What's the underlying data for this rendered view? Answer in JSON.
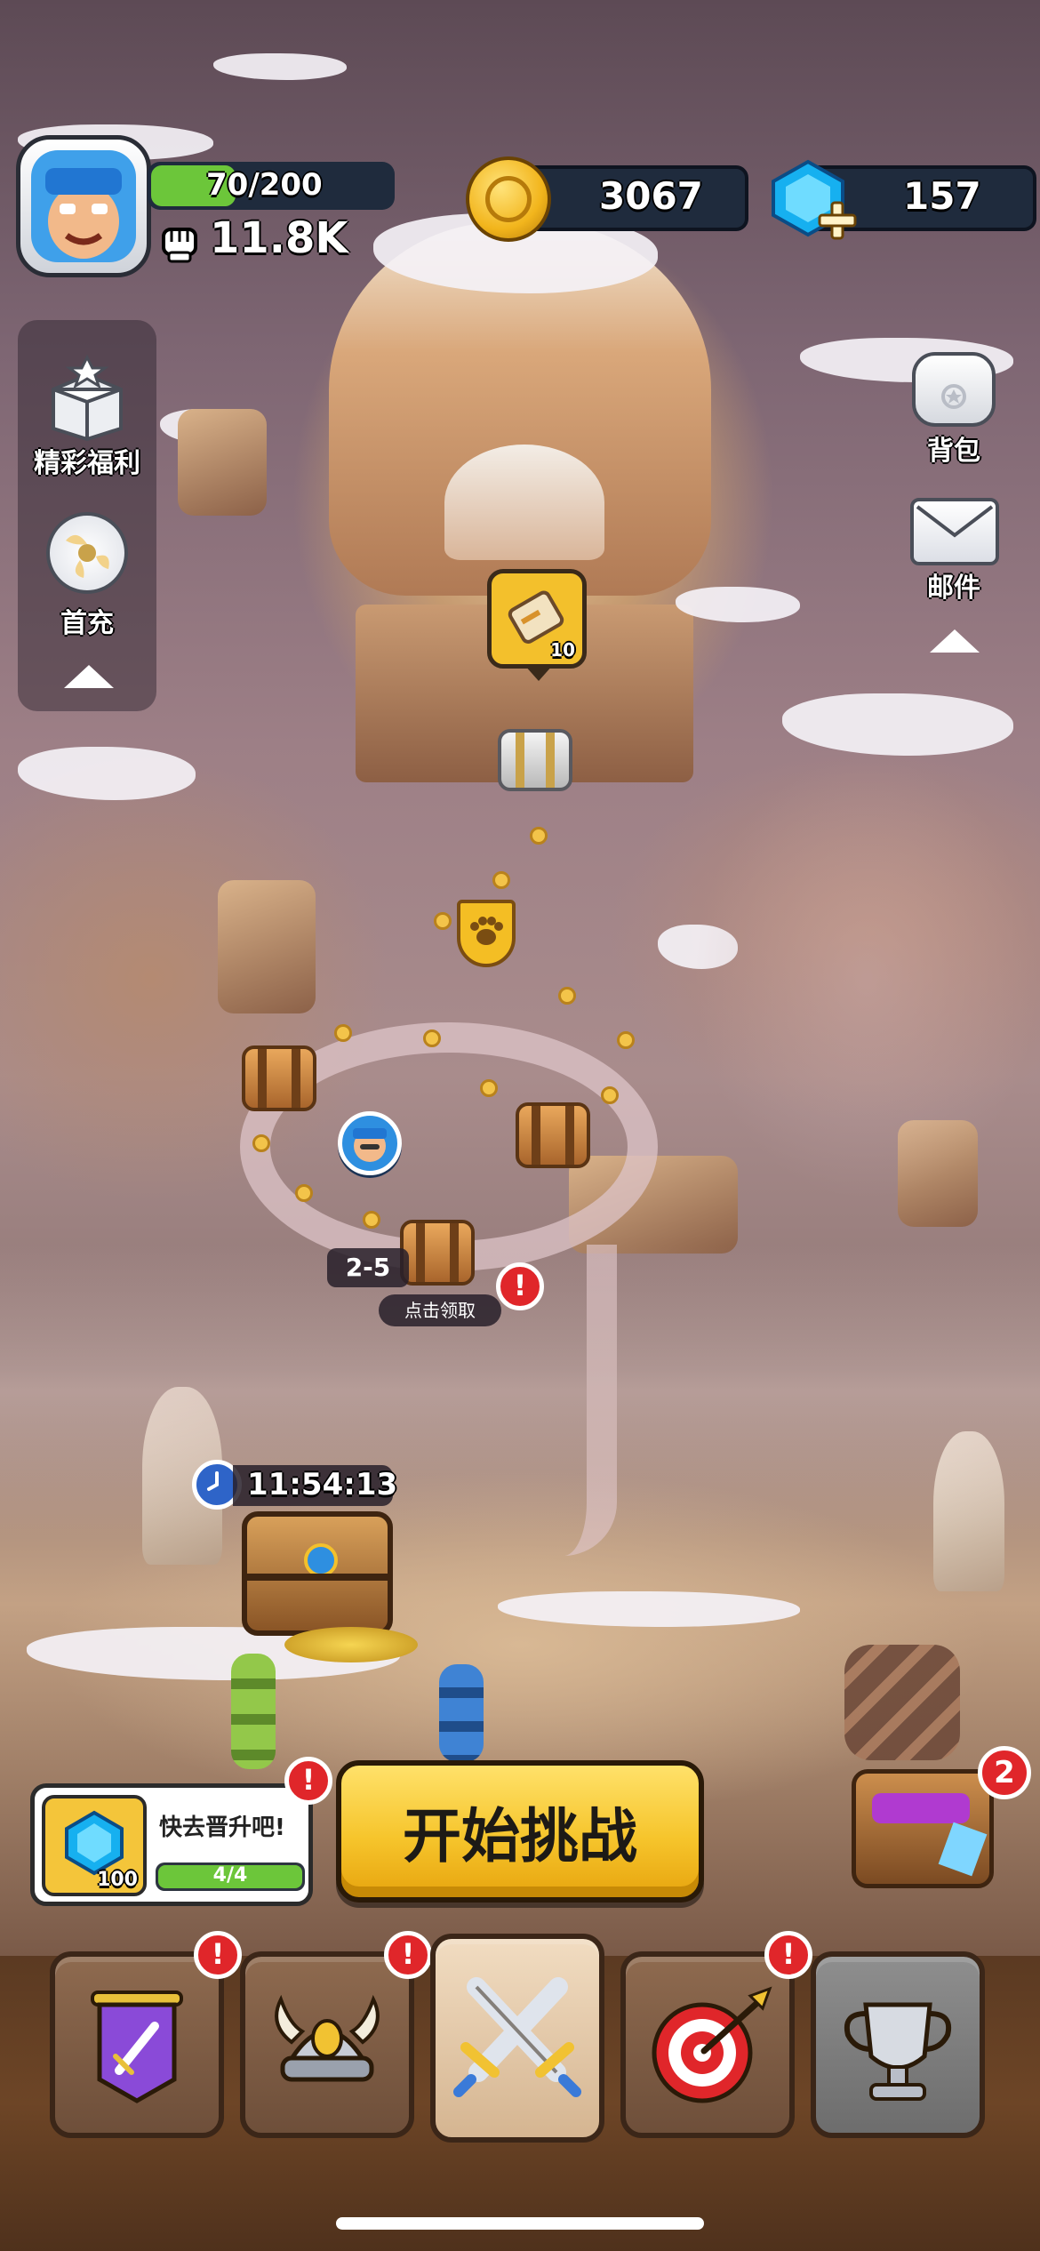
{
  "player": {
    "xp_text": "70/200",
    "xp_progress": 0.35,
    "power": "11.8K"
  },
  "currency": {
    "coins": "3067",
    "gems": "157"
  },
  "left_menu": {
    "rewards_label": "精彩福利",
    "first_recharge_label": "首充"
  },
  "right_menu": {
    "backpack_label": "背包",
    "mail_label": "邮件"
  },
  "map": {
    "scroll_badge_count": "10",
    "stage_label": "2-5",
    "claim_label": "点击领取",
    "timer": "11:54:13"
  },
  "promo": {
    "text": "快去晋升吧!",
    "gem_amount": "100",
    "progress_text": "4/4",
    "progress": 1.0
  },
  "start_button_label": "开始挑战",
  "chest_badge": "2",
  "alerts": {
    "symbol": "!"
  },
  "nav": {
    "items": [
      "guild-banner",
      "viking-helmet",
      "crossed-swords",
      "target",
      "trophy"
    ],
    "active": "crossed-swords"
  },
  "colors": {
    "gold": "#f4c53a",
    "gem_blue": "#1aa6e8",
    "xp_green": "#6cc63a",
    "alert_red": "#e0262a"
  }
}
